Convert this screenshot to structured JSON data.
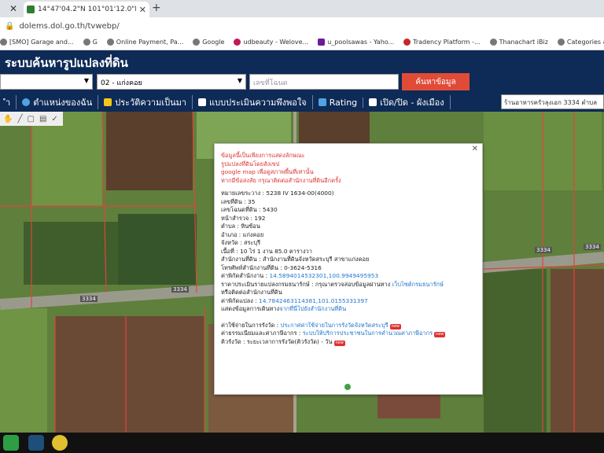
{
  "browser": {
    "tab_title": "14°47'04.2\"N 101°01'12.0\"E - Go",
    "url": "dolems.dol.go.th/tvwebp/",
    "bookmarks": [
      "[SMO] Garage and...",
      "G",
      "Online Payment, Pa...",
      "Google",
      "udbeauty - Welove...",
      "u_poolsawas - Yaho...",
      "Tradency Platform -...",
      "Thanachart iBiz",
      "Categories & more"
    ]
  },
  "app": {
    "title": "ระบบค้นหารูปแปลงที่ดิน",
    "district_select": "02 - แก่งคอย",
    "parcel_placeholder": "เลขที่โฉนด",
    "search_button": "ค้นหาข้อมูล",
    "menu": [
      "ำ",
      "ตำแหน่งของฉัน",
      "ประวัติความเป็นมา",
      "แบบประเมินความพึงพอใจ",
      "Rating",
      "เปิด/ปิด - ผังเมือง"
    ],
    "map_search_text": "ร้านอาหารครัวลุงเอก 3334 ตำบล"
  },
  "popup": {
    "disclaimer": [
      "ข้อมูลนี้เป็นเพียงการแสดงลักษณะ",
      "รูปแปลงที่ดินโดยสังเขป",
      "google map เพื่อดูสภาพพื้นที่เท่านั้น",
      "หากมีข้อสงสัย กรุณาติดต่อสำนักงานที่ดินอีกครั้ง"
    ],
    "fields": [
      "หมายเลขระวาง : 5238 IV 1634-00(4000)",
      "เลขที่ดิน : 35",
      "เลขโฉนดที่ดิน : 5430",
      "หน้าสำรวจ : 192",
      "ตำบล : หินซ้อน",
      "อำเภอ : แก่งคอย",
      "จังหวัด : สระบุรี",
      "เนื้อที่ : 10 ไร่ 1 งาน 85.0 ตารางวา",
      "สำนักงานที่ดิน : สำนักงานที่ดินจังหวัดสระบุรี สาขาแก่งคอย",
      "โทรศัพท์สำนักงานที่ดิน : 0-3624-5316"
    ],
    "office_coord_label": "ค่าพิกัดสำนักงาน :",
    "office_coord": "14.5894014532301,100.9949495953",
    "appraisal_label": "ราคาประเมินรายแปลงกรมธนารักษ์ : กรุณาตรวจสอบข้อมูลผ่านทาง",
    "appraisal_link": "เว็บไซต์กรมธนารักษ์",
    "appraisal_tail": "หรือติดต่อสำนักงานที่ดิน",
    "parcel_coord_label": "ค่าพิกัดแปลง :",
    "parcel_coord": "14.7842463114381,101.0155331397",
    "route_label": "แสดงข้อมูลการเดินทาง",
    "route_link": "จากที่นี่ไปยังสำนักงานที่ดิน",
    "links": [
      {
        "label": "ค่าใช้จ่ายในการรังวัด :",
        "link": "ประกาศค่าใช้จ่ายในการรังวัดจังหวัดสระบุรี",
        "badge": "new"
      },
      {
        "label": "ค่าธรรมเนียมและค่าภาษีอากร :",
        "link": "ระบบให้บริการประชาชนในการคำนวณค่าภาษีอากร",
        "badge": "new"
      },
      {
        "label": "คิวรังวัด :",
        "link": "ระยะเวลาการรังวัด(คิวรังวัด) - วัน",
        "badge": "new"
      }
    ]
  },
  "map_labels": [
    "3334",
    "3334",
    "3334",
    "3334"
  ]
}
